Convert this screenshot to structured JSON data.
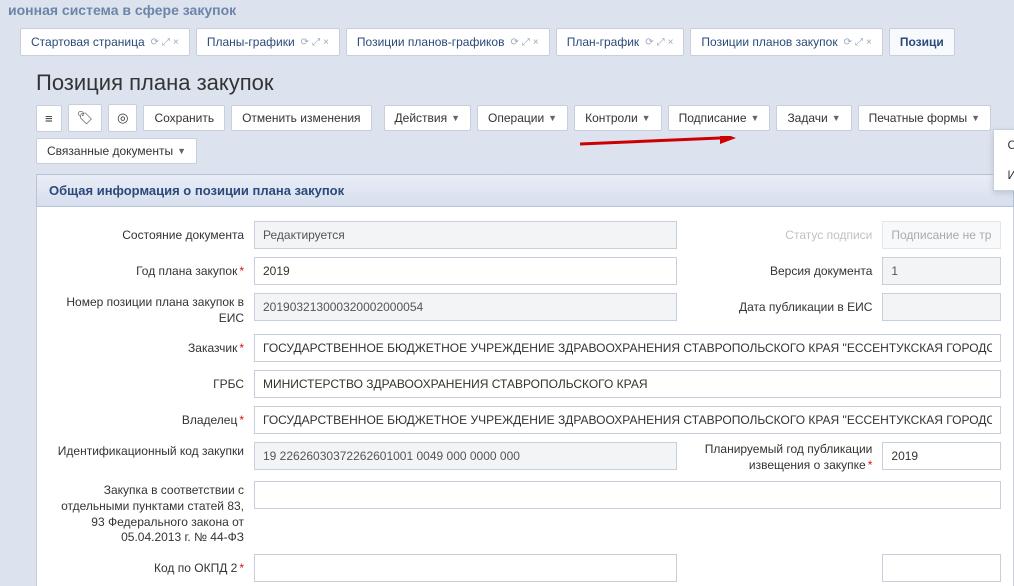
{
  "appTitle": "ионная система в сфере закупок",
  "tabs": [
    {
      "label": "Стартовая страница"
    },
    {
      "label": "Планы-графики"
    },
    {
      "label": "Позиции планов-графиков"
    },
    {
      "label": "План-график"
    },
    {
      "label": "Позиции планов закупок"
    },
    {
      "label": "Позици"
    }
  ],
  "pageTitle": "Позиция плана закупок",
  "toolbar": {
    "save": "Сохранить",
    "cancel": "Отменить изменения",
    "actions": "Действия",
    "operations": "Операции",
    "controls": "Контроли",
    "signing": "Подписание",
    "tasks": "Задачи",
    "printForms": "Печатные формы",
    "linkedDocs": "Связанные документы"
  },
  "dropdown": {
    "item1": "Сметные (плановые) назначения",
    "item2": "Информация о связанных документах"
  },
  "sectionTitle": "Общая информация о позиции плана закупок",
  "labels": {
    "docState": "Состояние документа",
    "planYear": "Год плана закупок",
    "posNumber": "Номер позиции плана закупок в ЕИС",
    "customer": "Заказчик",
    "grbs": "ГРБС",
    "owner": "Владелец",
    "idCode": "Идентификационный код закупки",
    "law": "Закупка в соответствии с отдельными пунктами статей 83, 93 Федерального закона от 05.04.2013 г. № 44-ФЗ",
    "okpd": "Код по ОКПД 2",
    "statusSign": "Статус подписи",
    "signNotReq": "Подписание не тр",
    "docVersion": "Версия документа",
    "pubDate": "Дата публикации в ЕИС",
    "plannedYear": "Планируемый год публикации извещения о закупке"
  },
  "values": {
    "docState": "Редактируется",
    "planYear": "2019",
    "posNumber": "201903213000320002000054",
    "customer": "ГОСУДАРСТВЕННОЕ БЮДЖЕТНОЕ УЧРЕЖДЕНИЕ ЗДРАВООХРАНЕНИЯ СТАВРОПОЛЬСКОГО КРАЯ \"ЕССЕНТУКСКАЯ ГОРОДСКАЯ СТАНЦИ",
    "grbs": "МИНИСТЕРСТВО ЗДРАВООХРАНЕНИЯ СТАВРОПОЛЬСКОГО КРАЯ",
    "owner": "ГОСУДАРСТВЕННОЕ БЮДЖЕТНОЕ УЧРЕЖДЕНИЕ ЗДРАВООХРАНЕНИЯ СТАВРОПОЛЬСКОГО КРАЯ \"ЕССЕНТУКСКАЯ ГОРОДСКАЯ СТАНЦИ",
    "idCode": "19 2262603037226260100​1 0049 000 0000 000",
    "docVersion": "1",
    "plannedYear": "2019"
  }
}
